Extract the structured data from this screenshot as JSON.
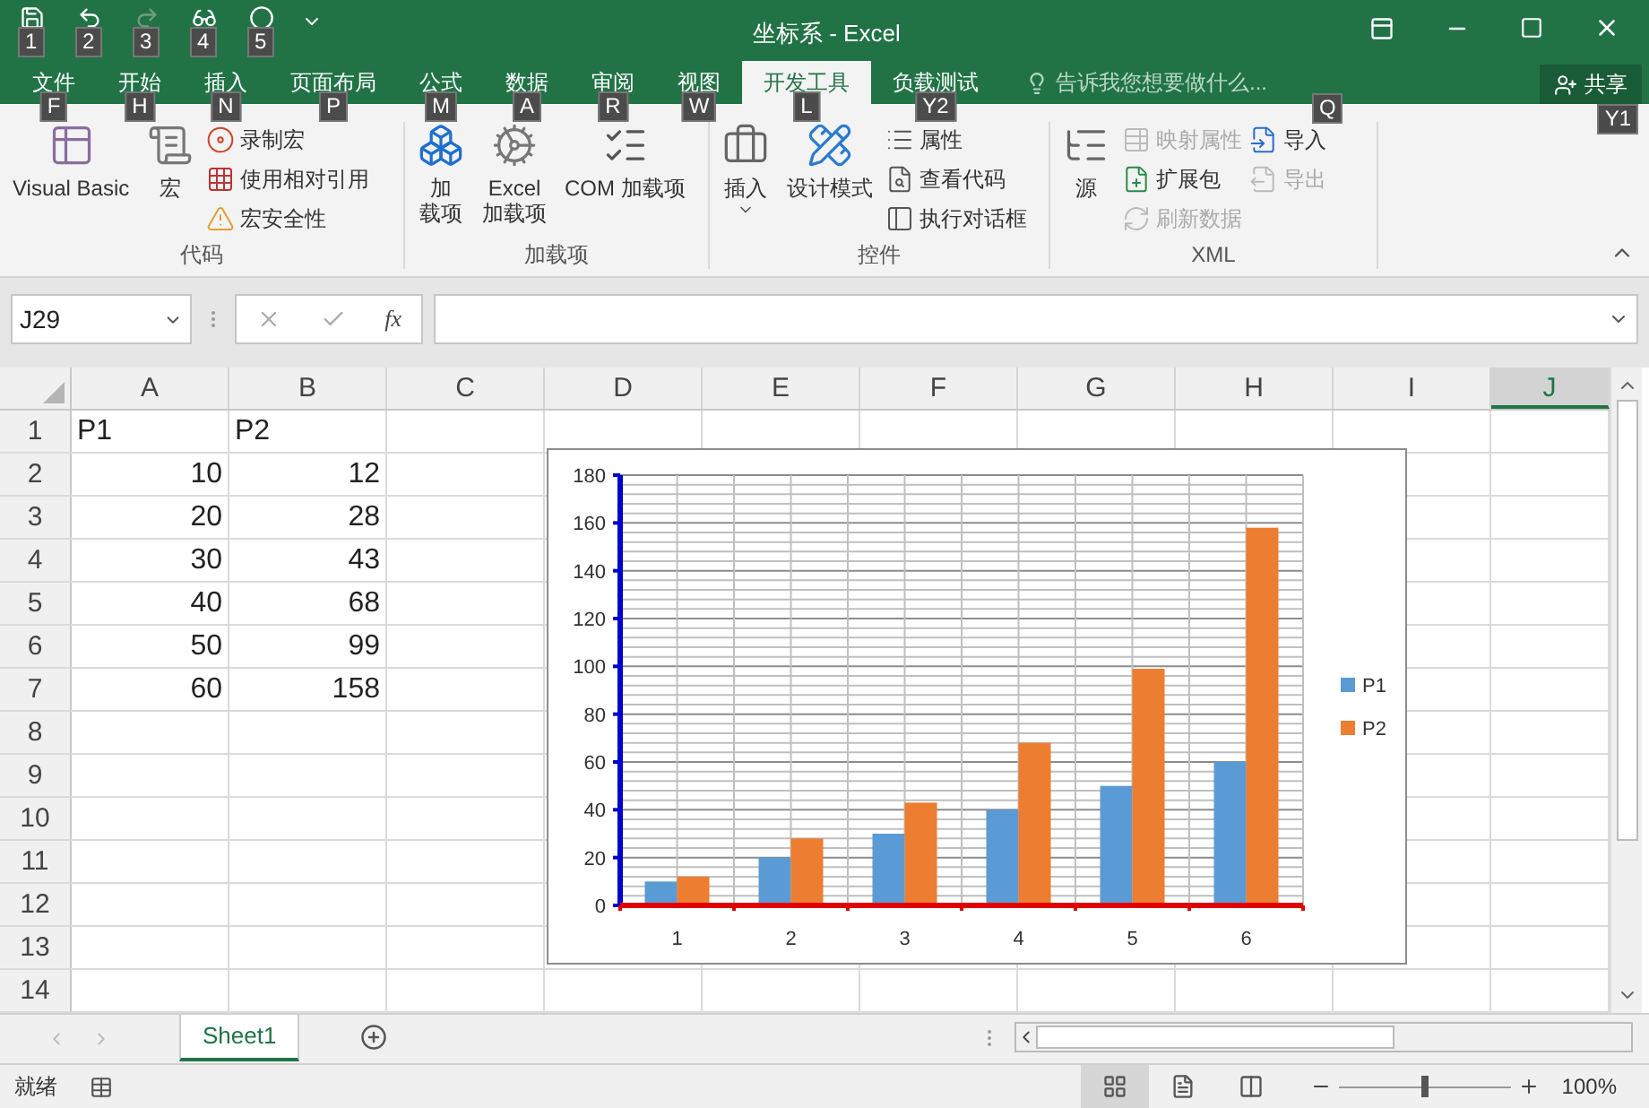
{
  "window": {
    "title": "坐标系 - Excel"
  },
  "quick_access": [
    {
      "keytip": "1",
      "disabled": false
    },
    {
      "keytip": "2",
      "disabled": false
    },
    {
      "keytip": "3",
      "disabled": true
    },
    {
      "keytip": "4",
      "disabled": false
    },
    {
      "keytip": "5",
      "disabled": false
    }
  ],
  "tabs": [
    {
      "label": "文件",
      "keytip": "F",
      "selected": false
    },
    {
      "label": "开始",
      "keytip": "H",
      "selected": false
    },
    {
      "label": "插入",
      "keytip": "N",
      "selected": false
    },
    {
      "label": "页面布局",
      "keytip": "P",
      "selected": false
    },
    {
      "label": "公式",
      "keytip": "M",
      "selected": false
    },
    {
      "label": "数据",
      "keytip": "A",
      "selected": false
    },
    {
      "label": "审阅",
      "keytip": "R",
      "selected": false
    },
    {
      "label": "视图",
      "keytip": "W",
      "selected": false
    },
    {
      "label": "开发工具",
      "keytip": "L",
      "selected": true
    },
    {
      "label": "负载测试",
      "keytip": "Y2",
      "selected": false
    }
  ],
  "tell_me": {
    "placeholder": "告诉我您想要做什么...",
    "keytip": "Q"
  },
  "share": {
    "label": "共享",
    "keytip": "Y1"
  },
  "ribbon_groups": [
    {
      "label": "代码",
      "items": [
        {
          "lines": [
            "Visual Basic"
          ],
          "kind": "large",
          "disabled": false
        },
        {
          "lines": [
            "宏"
          ],
          "kind": "large",
          "disabled": false
        },
        {
          "kind": "column",
          "items": [
            {
              "label": "录制宏",
              "disabled": false
            },
            {
              "label": "使用相对引用",
              "disabled": false
            },
            {
              "label": "宏安全性",
              "disabled": false
            }
          ]
        }
      ]
    },
    {
      "label": "加载项",
      "items": [
        {
          "lines": [
            "加",
            "载项"
          ],
          "kind": "large",
          "disabled": false
        },
        {
          "lines": [
            "Excel",
            "加载项"
          ],
          "kind": "large",
          "disabled": false
        },
        {
          "lines": [
            "COM 加载项"
          ],
          "kind": "large",
          "disabled": false
        }
      ]
    },
    {
      "label": "控件",
      "items": [
        {
          "lines": [
            "插入"
          ],
          "kind": "large",
          "disabled": false,
          "dropdown": true
        },
        {
          "lines": [
            "设计模式"
          ],
          "kind": "large",
          "disabled": false
        },
        {
          "kind": "column",
          "items": [
            {
              "label": "属性",
              "disabled": false
            },
            {
              "label": "查看代码",
              "disabled": false
            },
            {
              "label": "执行对话框",
              "disabled": false
            }
          ]
        }
      ]
    },
    {
      "label": "XML",
      "items": [
        {
          "lines": [
            "源"
          ],
          "kind": "large",
          "disabled": false
        },
        {
          "kind": "column",
          "items": [
            {
              "label": "映射属性",
              "disabled": true
            },
            {
              "label": "扩展包",
              "disabled": false
            },
            {
              "label": "刷新数据",
              "disabled": true
            }
          ]
        },
        {
          "kind": "column",
          "items": [
            {
              "label": "导入",
              "disabled": false
            },
            {
              "label": "导出",
              "disabled": true
            }
          ]
        }
      ]
    }
  ],
  "formula_bar": {
    "name_box": "J29",
    "function_label": "fx"
  },
  "sheet": {
    "columns": [
      {
        "label": "A",
        "selected": false
      },
      {
        "label": "B",
        "selected": false
      },
      {
        "label": "C",
        "selected": false
      },
      {
        "label": "D",
        "selected": false
      },
      {
        "label": "E",
        "selected": false
      },
      {
        "label": "F",
        "selected": false
      },
      {
        "label": "G",
        "selected": false
      },
      {
        "label": "H",
        "selected": false
      },
      {
        "label": "I",
        "selected": false
      },
      {
        "label": "J",
        "selected": true
      }
    ],
    "rows": [
      {
        "label": "1",
        "cells": [
          {
            "text": "P1",
            "kind": "text"
          },
          {
            "text": "P2",
            "kind": "text"
          }
        ]
      },
      {
        "label": "2",
        "cells": [
          {
            "text": "10",
            "kind": "number"
          },
          {
            "text": "12",
            "kind": "number"
          }
        ]
      },
      {
        "label": "3",
        "cells": [
          {
            "text": "20",
            "kind": "number"
          },
          {
            "text": "28",
            "kind": "number"
          }
        ]
      },
      {
        "label": "4",
        "cells": [
          {
            "text": "30",
            "kind": "number"
          },
          {
            "text": "43",
            "kind": "number"
          }
        ]
      },
      {
        "label": "5",
        "cells": [
          {
            "text": "40",
            "kind": "number"
          },
          {
            "text": "68",
            "kind": "number"
          }
        ]
      },
      {
        "label": "6",
        "cells": [
          {
            "text": "50",
            "kind": "number"
          },
          {
            "text": "99",
            "kind": "number"
          }
        ]
      },
      {
        "label": "7",
        "cells": [
          {
            "text": "60",
            "kind": "number"
          },
          {
            "text": "158",
            "kind": "number"
          }
        ]
      },
      {
        "label": "8",
        "cells": []
      },
      {
        "label": "9",
        "cells": []
      },
      {
        "label": "10",
        "cells": []
      },
      {
        "label": "11",
        "cells": []
      },
      {
        "label": "12",
        "cells": []
      },
      {
        "label": "13",
        "cells": []
      },
      {
        "label": "14",
        "cells": []
      }
    ]
  },
  "chart": {
    "chart_data": {
      "type": "bar",
      "categories": [
        "1",
        "2",
        "3",
        "4",
        "5",
        "6"
      ],
      "series": [
        {
          "name": "P1",
          "color": "#5b9bd5",
          "values": [
            10,
            20,
            30,
            40,
            50,
            60
          ]
        },
        {
          "name": "P2",
          "color": "#ed7d31",
          "values": [
            12,
            28,
            43,
            68,
            99,
            158
          ]
        }
      ],
      "ylim": [
        0,
        180
      ],
      "yticks": [
        0,
        20,
        40,
        60,
        80,
        100,
        120,
        140,
        160,
        180
      ],
      "grid": true,
      "legend": true
    }
  },
  "sheet_tabs": [
    {
      "label": "Sheet1",
      "selected": true
    }
  ],
  "status_bar": {
    "status": "就绪",
    "views": [
      {
        "selected": true
      },
      {
        "selected": false
      },
      {
        "selected": false
      }
    ],
    "zoom": {
      "level": 0.5,
      "reading": "100%"
    }
  }
}
